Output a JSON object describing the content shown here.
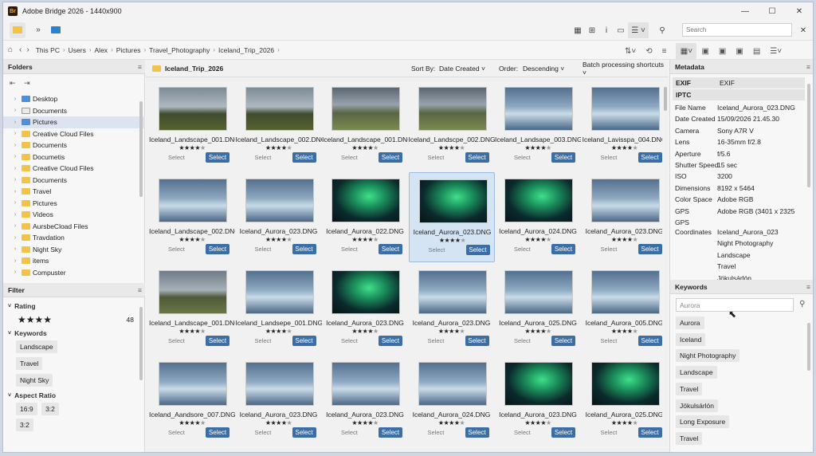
{
  "window": {
    "title": "Adobe Bridge 2026 - 1440x900",
    "app_badge": "Br"
  },
  "search": {
    "placeholder": "Search"
  },
  "path": {
    "crumbs": [
      "This PC",
      "Users",
      "Alex",
      "Pictures",
      "Travel_Photography",
      "Iceland_Trip_2026"
    ]
  },
  "folders_panel": {
    "title": "Folders",
    "items": [
      {
        "label": "Desktop",
        "icon": "desktop-folder-icon"
      },
      {
        "label": "Documents",
        "icon": "document-icon"
      },
      {
        "label": "Pictures",
        "icon": "pictures-folder-icon",
        "selected": true
      },
      {
        "label": "Creative Cloud Files",
        "icon": "folder-icon"
      },
      {
        "label": "Documents",
        "icon": "folder-icon"
      },
      {
        "label": "Documetis",
        "icon": "folder-icon"
      },
      {
        "label": "Creative Cloud Files",
        "icon": "folder-icon"
      },
      {
        "label": "Documents",
        "icon": "folder-icon"
      },
      {
        "label": "Travel",
        "icon": "folder-icon"
      },
      {
        "label": "Pictures",
        "icon": "folder-icon"
      },
      {
        "label": "Videos",
        "icon": "folder-icon"
      },
      {
        "label": "AursbeCload Files",
        "icon": "folder-icon"
      },
      {
        "label": "Travdation",
        "icon": "folder-icon"
      },
      {
        "label": "Night Sky",
        "icon": "folder-icon"
      },
      {
        "label": "items",
        "icon": "folder-icon"
      },
      {
        "label": "Compuster",
        "icon": "folder-icon"
      }
    ]
  },
  "filter_panel": {
    "title": "Filter",
    "rating_label": "Rating",
    "rating_stars": "★★★★",
    "rating_count": "48",
    "keywords_label": "Keywords",
    "keywords": [
      "Landscape",
      "Travel",
      "Night Sky"
    ],
    "aspect_label": "Aspect Ratio",
    "aspects": [
      "16:9",
      "3:2",
      "3:2"
    ]
  },
  "content": {
    "folder": "Iceland_Trip_2026",
    "sort_label": "Sort By:",
    "sort_value": "Date Created",
    "order_label": "Order:",
    "order_value": "Descending",
    "batch_label": "Batch processing shortcuts",
    "select_text": "Select",
    "select_button": "Select",
    "items": [
      {
        "name": "Iceland_Landscape_001.DNG",
        "rating": 4,
        "scene": "mountain"
      },
      {
        "name": "Iceland_Landscape_002.DNG",
        "rating": 4,
        "scene": "mountain"
      },
      {
        "name": "Iceland_Landscape_001.DNG",
        "rating": 4,
        "scene": "waterfall"
      },
      {
        "name": "Iceland_Landscpe_002.DNG",
        "rating": 4,
        "scene": "waterfall"
      },
      {
        "name": "Iceland_Landsape_003.DNG",
        "rating": 4,
        "scene": "ice"
      },
      {
        "name": "Iceland_Lavisspa_004.DNG",
        "rating": 4,
        "scene": "ice"
      },
      {
        "name": "Iceland_Landscape_002.DNG",
        "rating": 4,
        "scene": "ice"
      },
      {
        "name": "Iceland_Aurora_023.DNG",
        "rating": 4,
        "scene": "ice"
      },
      {
        "name": "Iceland_Aurora_022.DNG",
        "rating": 4,
        "scene": "aurora"
      },
      {
        "name": "Iceland_Aurora_023.DNG",
        "rating": 4,
        "scene": "aurora",
        "selected": true
      },
      {
        "name": "Iceland_Aurora_024.DNG",
        "rating": 4,
        "scene": "aurora"
      },
      {
        "name": "Iceland_Aurora_023.DNG",
        "rating": 4,
        "scene": "ice"
      },
      {
        "name": "Iceland_Landscape_001.DNG",
        "rating": 4,
        "scene": "plain"
      },
      {
        "name": "Iceland_Landsepe_001.DNG",
        "rating": 4,
        "scene": "ice"
      },
      {
        "name": "Iceland_Aurora_023.DNG",
        "rating": 4,
        "scene": "aurora"
      },
      {
        "name": "Iceland_Aurora_023.DNG",
        "rating": 4,
        "scene": "ice"
      },
      {
        "name": "Iceland_Aurora_025.DNG",
        "rating": 4,
        "scene": "ice"
      },
      {
        "name": "Iceland_Aurora_005.DNG",
        "rating": 4,
        "scene": "ice"
      },
      {
        "name": "Iceland_Aandsore_007.DNG",
        "rating": 4,
        "scene": "ice"
      },
      {
        "name": "Iceland_Aurora_023.DNG",
        "rating": 4,
        "scene": "ice"
      },
      {
        "name": "Iceland_Aurora_023.DNG",
        "rating": 4,
        "scene": "ice"
      },
      {
        "name": "Iceland_Aurora_024.DNG",
        "rating": 4,
        "scene": "ice"
      },
      {
        "name": "Iceland_Aurora_023.DNG",
        "rating": 4,
        "scene": "aurora"
      },
      {
        "name": "Iceland_Aurora_025.DNG",
        "rating": 4,
        "scene": "aurora"
      }
    ]
  },
  "metadata_panel": {
    "title": "Metadata",
    "exif_label": "EXIF",
    "exif_value": "EXIF",
    "iptc_label": "IPTC",
    "rows": [
      {
        "label": "File Name",
        "value": "Iceland_Aurora_023.DNG"
      },
      {
        "label": "Date Created",
        "value": "15/09/2026 21.45.30"
      },
      {
        "label": "Camera",
        "value": "Sony A7R V"
      },
      {
        "label": "Lens",
        "value": "16-35mm f/2.8"
      },
      {
        "label": "Aperture",
        "value": "f/5.6"
      },
      {
        "label": "Shutter Speed",
        "value": "15 sec"
      },
      {
        "label": "ISO",
        "value": "3200"
      },
      {
        "label": "Dimensions",
        "value": "8192 x 5464"
      },
      {
        "label": "Color Space",
        "value": "Adobe RGB"
      },
      {
        "label": "GPS",
        "value": "Adobe RGB (3401 x 2325"
      }
    ],
    "gps_coords_label_1": "GPS",
    "gps_coords_label_2": "Coordinates",
    "extra_values": [
      "Iceland_Aurora_023",
      "Night Photography",
      "Landscape",
      "Travel",
      "Jökulsárlón"
    ]
  },
  "keywords_panel": {
    "title": "Keywords",
    "input_value": "Aurora",
    "items": [
      "Aurora",
      "Iceland",
      "Night Photography",
      "Landscape",
      "Travel",
      "Jökulsárlón",
      "Long Exposure",
      "Travel"
    ]
  }
}
